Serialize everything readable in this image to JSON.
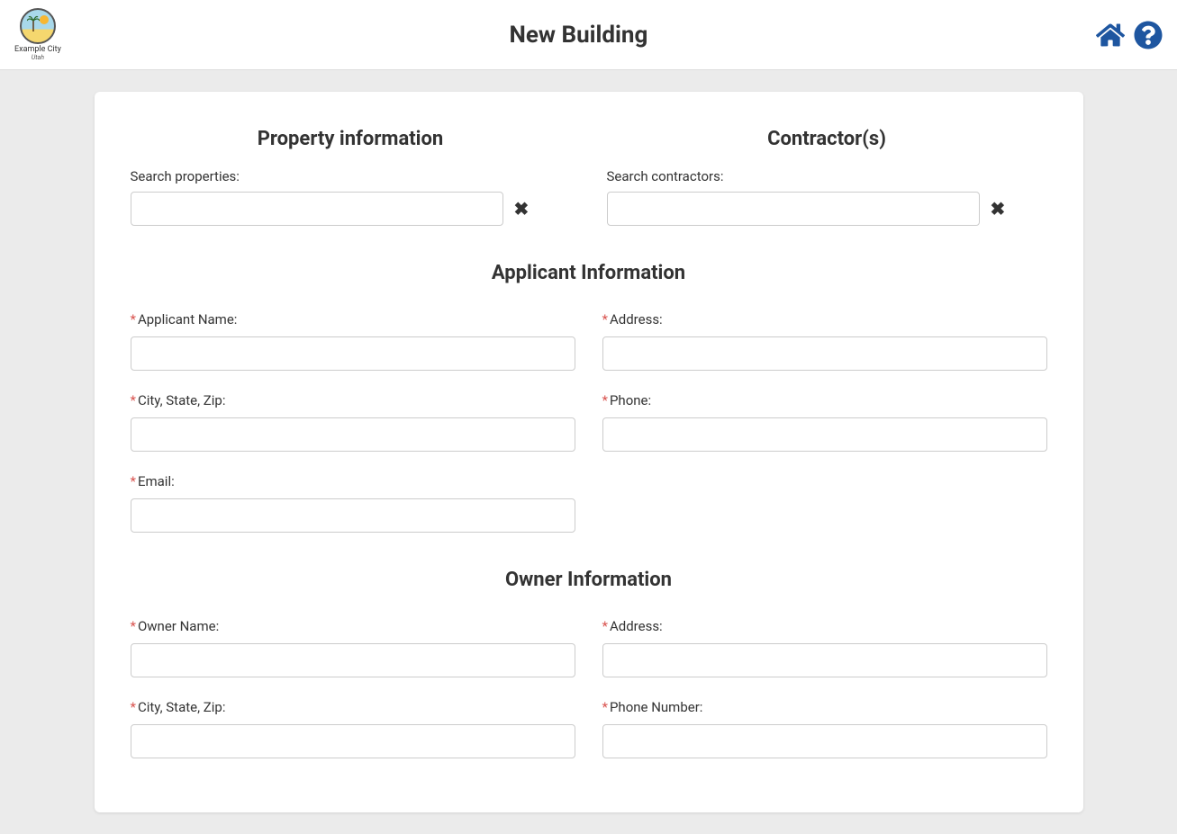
{
  "header": {
    "logo_text": "Example City",
    "logo_subtext": "Utah",
    "title": "New Building"
  },
  "sections": {
    "property": {
      "heading": "Property information",
      "search_label": "Search properties:"
    },
    "contractor": {
      "heading": "Contractor(s)",
      "search_label": "Search contractors:"
    },
    "applicant": {
      "heading": "Applicant Information",
      "fields": {
        "name": {
          "label": "Applicant Name:",
          "required": true
        },
        "address": {
          "label": "Address:",
          "required": true
        },
        "city_state_zip": {
          "label": "City, State, Zip:",
          "required": true
        },
        "phone": {
          "label": "Phone:",
          "required": true
        },
        "email": {
          "label": "Email:",
          "required": true
        }
      }
    },
    "owner": {
      "heading": "Owner Information",
      "fields": {
        "name": {
          "label": "Owner Name:",
          "required": true
        },
        "address": {
          "label": "Address:",
          "required": true
        },
        "city_state_zip": {
          "label": "City, State, Zip:",
          "required": true
        },
        "phone": {
          "label": "Phone Number:",
          "required": true
        }
      }
    }
  },
  "required_mark": "*"
}
